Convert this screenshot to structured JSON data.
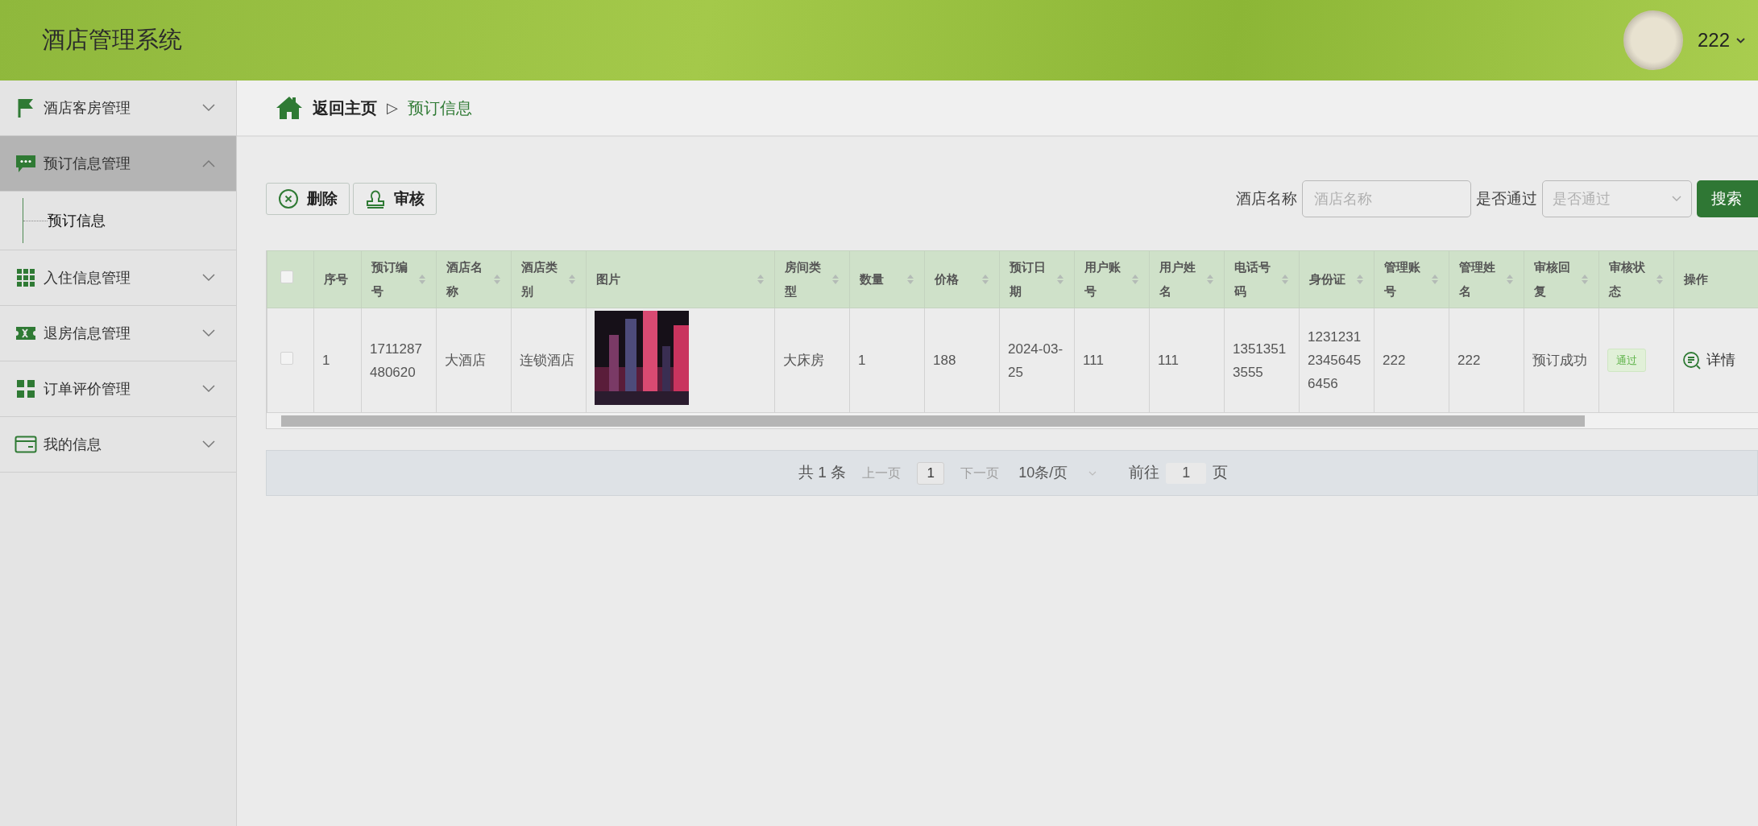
{
  "header": {
    "title": "酒店管理系统",
    "user": {
      "name": "222"
    }
  },
  "sidebar": {
    "items": [
      {
        "label": "酒店客房管理",
        "expanded": false,
        "selected": false
      },
      {
        "label": "预订信息管理",
        "expanded": true,
        "selected": true,
        "children": [
          {
            "label": "预订信息",
            "selected": true
          }
        ]
      },
      {
        "label": "入住信息管理",
        "expanded": false,
        "selected": false
      },
      {
        "label": "退房信息管理",
        "expanded": false,
        "selected": false
      },
      {
        "label": "订单评价管理",
        "expanded": false,
        "selected": false
      },
      {
        "label": "我的信息",
        "expanded": false,
        "selected": false
      }
    ]
  },
  "breadcrumb": {
    "home": "返回主页",
    "separator": "▷",
    "current": "预订信息"
  },
  "toolbar": {
    "buttons": [
      {
        "label": "删除"
      },
      {
        "label": "审核"
      }
    ],
    "filters": [
      {
        "kind": "input",
        "label": "酒店名称",
        "placeholder": "酒店名称"
      },
      {
        "kind": "select",
        "label": "是否通过",
        "placeholder": "是否通过"
      }
    ],
    "search": "搜索"
  },
  "table": {
    "select_all": {
      "checked": false
    },
    "columns": [
      {
        "label": "序号",
        "sortable": false
      },
      {
        "label": "预订编号",
        "sortable": true
      },
      {
        "label": "酒店名称",
        "sortable": true
      },
      {
        "label": "酒店类别",
        "sortable": true
      },
      {
        "label": "图片",
        "sortable": true
      },
      {
        "label": "房间类型",
        "sortable": true
      },
      {
        "label": "数量",
        "sortable": true
      },
      {
        "label": "价格",
        "sortable": true
      },
      {
        "label": "预订日期",
        "sortable": true
      },
      {
        "label": "用户账号",
        "sortable": true
      },
      {
        "label": "用户姓名",
        "sortable": true
      },
      {
        "label": "电话号码",
        "sortable": true
      },
      {
        "label": "身份证",
        "sortable": true
      },
      {
        "label": "管理账号",
        "sortable": true
      },
      {
        "label": "管理姓名",
        "sortable": true
      },
      {
        "label": "审核回复",
        "sortable": true
      },
      {
        "label": "审核状态",
        "sortable": true
      },
      {
        "label": "操作",
        "sortable": false
      }
    ],
    "rows": [
      {
        "checked": false,
        "cells": [
          {
            "kind": "text",
            "text": "1"
          },
          {
            "kind": "text",
            "text": "1711287480620"
          },
          {
            "kind": "text",
            "text": "大酒店"
          },
          {
            "kind": "text",
            "text": "连锁酒店"
          },
          {
            "kind": "image"
          },
          {
            "kind": "text",
            "text": "大床房"
          },
          {
            "kind": "text",
            "text": "1"
          },
          {
            "kind": "text",
            "text": "188"
          },
          {
            "kind": "text",
            "text": "2024-03-25"
          },
          {
            "kind": "text",
            "text": "111"
          },
          {
            "kind": "text",
            "text": "111"
          },
          {
            "kind": "text",
            "text": "13513513555"
          },
          {
            "kind": "text",
            "text": "123123123456456456"
          },
          {
            "kind": "text",
            "text": "222"
          },
          {
            "kind": "text",
            "text": "222"
          },
          {
            "kind": "text",
            "text": "预订成功"
          },
          {
            "kind": "badge",
            "text": "通过"
          },
          {
            "kind": "action",
            "text": "详情"
          }
        ]
      }
    ]
  },
  "pagination": {
    "total": "共 1 条",
    "prev": {
      "label": "上一页",
      "disabled": true
    },
    "page": "1",
    "next": {
      "label": "下一页",
      "disabled": true
    },
    "page_size": "10条/页",
    "goto_label": "前往",
    "goto_value": "1",
    "goto_suffix": "页"
  }
}
